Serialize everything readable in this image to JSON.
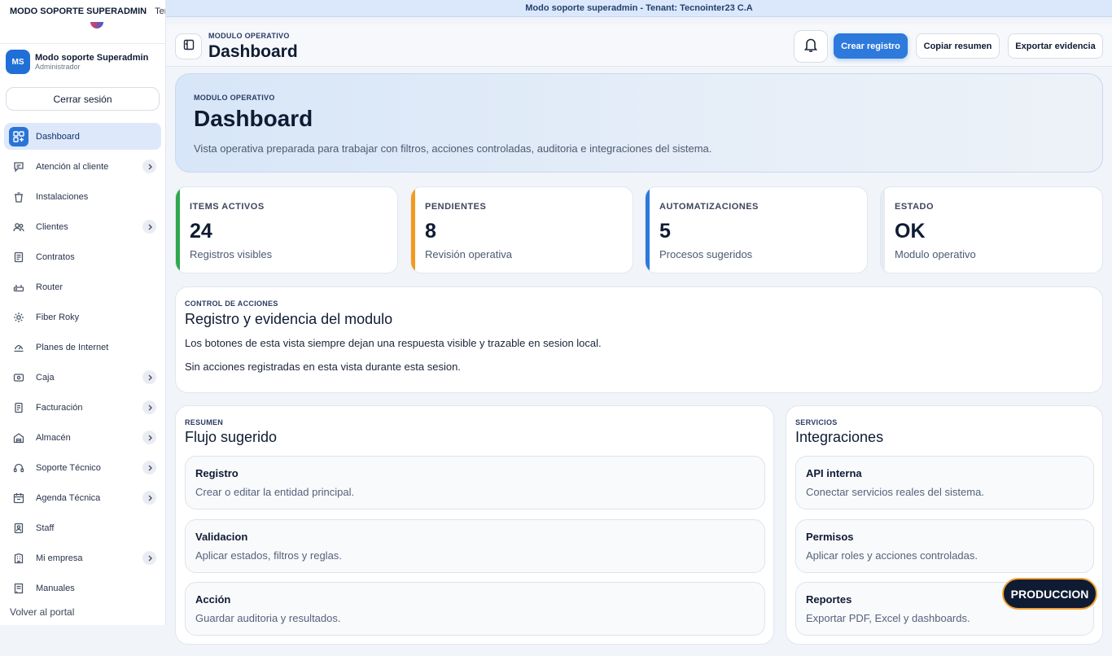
{
  "banner": {
    "text": "Modo soporte superadmin - Tenant: Tecnointer23 C.A"
  },
  "sidebar": {
    "top_title": "MODO SOPORTE SUPERADMIN",
    "top_tenant": "Tenant",
    "user": {
      "initials": "MS",
      "name": "Modo soporte Superadmin",
      "role": "Administrador"
    },
    "logout_label": "Cerrar sesión",
    "items": [
      {
        "label": "Dashboard",
        "icon": "grid-plus-icon",
        "active": true,
        "has_chevron": false
      },
      {
        "label": "Atención al cliente",
        "icon": "chat-icon",
        "has_chevron": true
      },
      {
        "label": "Instalaciones",
        "icon": "trash-icon",
        "has_chevron": false
      },
      {
        "label": "Clientes",
        "icon": "users-icon",
        "has_chevron": true
      },
      {
        "label": "Contratos",
        "icon": "document-icon",
        "has_chevron": false
      },
      {
        "label": "Router",
        "icon": "router-icon",
        "has_chevron": false
      },
      {
        "label": "Fiber Roky",
        "icon": "sun-icon",
        "has_chevron": false
      },
      {
        "label": "Planes de Internet",
        "icon": "gauge-icon",
        "has_chevron": false
      },
      {
        "label": "Caja",
        "icon": "cash-icon",
        "has_chevron": true
      },
      {
        "label": "Facturación",
        "icon": "invoice-icon",
        "has_chevron": true
      },
      {
        "label": "Almacén",
        "icon": "warehouse-icon",
        "has_chevron": true
      },
      {
        "label": "Soporte Técnico",
        "icon": "headset-icon",
        "has_chevron": true
      },
      {
        "label": "Agenda Técnica",
        "icon": "calendar-icon",
        "has_chevron": true
      },
      {
        "label": "Staff",
        "icon": "badge-icon",
        "has_chevron": false
      },
      {
        "label": "Mi empresa",
        "icon": "building-icon",
        "has_chevron": true
      },
      {
        "label": "Manuales",
        "icon": "book-icon",
        "has_chevron": false
      }
    ],
    "back_label": "Volver al portal"
  },
  "header": {
    "eyebrow": "MODULO OPERATIVO",
    "title": "Dashboard",
    "create_label": "Crear registro",
    "copy_label": "Copiar resumen",
    "export_label": "Exportar evidencia"
  },
  "hero": {
    "eyebrow": "MODULO OPERATIVO",
    "title": "Dashboard",
    "description": "Vista operativa preparada para trabajar con filtros, acciones controladas, auditoria e integraciones del sistema."
  },
  "stats": [
    {
      "label": "ITEMS ACTIVOS",
      "value": "24",
      "sub": "Registros visibles",
      "color": "#2fa84f"
    },
    {
      "label": "PENDIENTES",
      "value": "8",
      "sub": "Revisión operativa",
      "color": "#f29a1f"
    },
    {
      "label": "AUTOMATIZACIONES",
      "value": "5",
      "sub": "Procesos sugeridos",
      "color": "#2d79dc"
    },
    {
      "label": "ESTADO",
      "value": "OK",
      "sub": "Modulo operativo",
      "color": "#e6ebf2"
    }
  ],
  "control": {
    "eyebrow": "CONTROL DE ACCIONES",
    "title": "Registro y evidencia del modulo",
    "line1": "Los botones de esta vista siempre dejan una respuesta visible y trazable en sesion local.",
    "line2": "Sin acciones registradas en esta vista durante esta sesion."
  },
  "summary": {
    "eyebrow": "RESUMEN",
    "title": "Flujo sugerido",
    "steps": [
      {
        "title": "Registro",
        "sub": "Crear o editar la entidad principal."
      },
      {
        "title": "Validacion",
        "sub": "Aplicar estados, filtros y reglas."
      },
      {
        "title": "Acción",
        "sub": "Guardar auditoria y resultados."
      }
    ]
  },
  "services": {
    "eyebrow": "SERVICIOS",
    "title": "Integraciones",
    "items": [
      {
        "title": "API interna",
        "sub": "Conectar servicios reales del sistema."
      },
      {
        "title": "Permisos",
        "sub": "Aplicar roles y acciones controladas."
      },
      {
        "title": "Reportes",
        "sub": "Exportar PDF, Excel y dashboards."
      }
    ]
  },
  "environment_badge": "PRODUCCION"
}
